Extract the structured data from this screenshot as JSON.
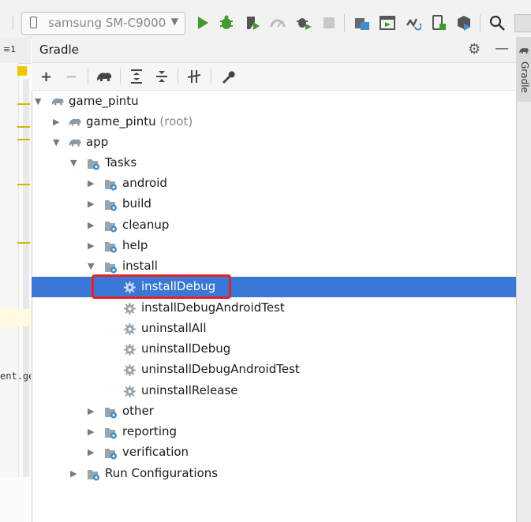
{
  "device": {
    "name": "samsung SM-C9000"
  },
  "panel": {
    "title": "Gradle",
    "side_tab": "Gradle"
  },
  "left_editor": {
    "cut_text": "ent.ge",
    "structure_icon": "≡1"
  },
  "toolbar_icons": [
    "run-icon",
    "debug-icon",
    "profile-icon",
    "apply-changes-icon",
    "attach-debugger-icon",
    "stop-icon",
    "sync-icon",
    "avd-icon",
    "sdk-icon",
    "device-file-icon",
    "search-icon"
  ],
  "panel_toolbar_icons": [
    "add-icon",
    "remove-icon",
    "gradle-elephant-icon",
    "expand-all-icon",
    "collapse-all-icon",
    "toggle-offline-icon",
    "settings-wrench-icon"
  ],
  "tree": [
    {
      "label": "game_pintu",
      "suffix": "",
      "icon": "elephant",
      "expanded": true
    },
    {
      "label": "game_pintu",
      "suffix": "(root)",
      "icon": "elephant",
      "expanded": false
    },
    {
      "label": "app",
      "suffix": "",
      "icon": "elephant",
      "expanded": true
    },
    {
      "label": "Tasks",
      "suffix": "",
      "icon": "folder-gear",
      "expanded": true
    },
    {
      "label": "android",
      "suffix": "",
      "icon": "folder-gear",
      "expanded": false
    },
    {
      "label": "build",
      "suffix": "",
      "icon": "folder-gear",
      "expanded": false
    },
    {
      "label": "cleanup",
      "suffix": "",
      "icon": "folder-gear",
      "expanded": false
    },
    {
      "label": "help",
      "suffix": "",
      "icon": "folder-gear",
      "expanded": false
    },
    {
      "label": "install",
      "suffix": "",
      "icon": "folder-gear",
      "expanded": true
    },
    {
      "label": "installDebug",
      "suffix": "",
      "icon": "gear",
      "selected": true
    },
    {
      "label": "installDebugAndroidTest",
      "suffix": "",
      "icon": "gear"
    },
    {
      "label": "uninstallAll",
      "suffix": "",
      "icon": "gear"
    },
    {
      "label": "uninstallDebug",
      "suffix": "",
      "icon": "gear"
    },
    {
      "label": "uninstallDebugAndroidTest",
      "suffix": "",
      "icon": "gear"
    },
    {
      "label": "uninstallRelease",
      "suffix": "",
      "icon": "gear"
    },
    {
      "label": "other",
      "suffix": "",
      "icon": "folder-gear",
      "expanded": false
    },
    {
      "label": "reporting",
      "suffix": "",
      "icon": "folder-gear",
      "expanded": false
    },
    {
      "label": "verification",
      "suffix": "",
      "icon": "folder-gear",
      "expanded": false
    },
    {
      "label": "Run Configurations",
      "suffix": "",
      "icon": "folder-gear",
      "expanded": false
    }
  ],
  "colors": {
    "selection": "#3a77d6",
    "highlight_box": "#e8211f",
    "run_green": "#3f9b2d",
    "icon_blue": "#3d8fd1"
  }
}
